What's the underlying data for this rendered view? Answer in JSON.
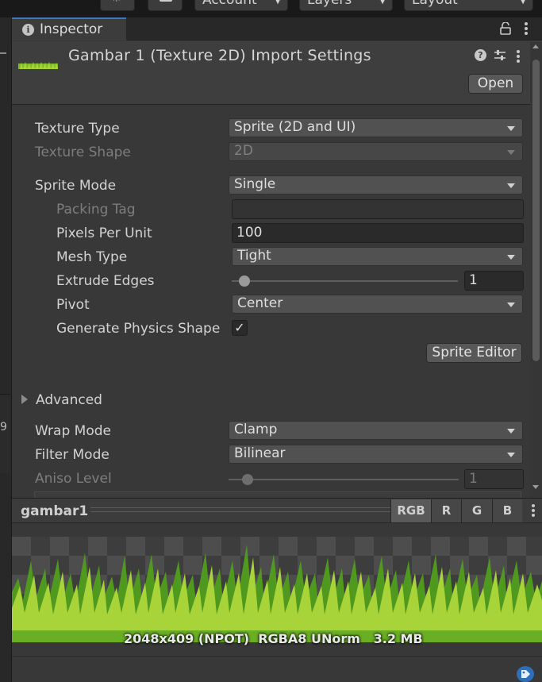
{
  "toolbar": {
    "account_label": "Account",
    "layers_label": "Layers",
    "layout_label": "Layout"
  },
  "left_strip": {
    "digit": "9"
  },
  "tab": {
    "label": "Inspector"
  },
  "header": {
    "title": "Gambar 1 (Texture 2D) Import Settings",
    "open_label": "Open"
  },
  "fields": {
    "texture_type": {
      "label": "Texture Type",
      "value": "Sprite (2D and UI)"
    },
    "texture_shape": {
      "label": "Texture Shape",
      "value": "2D"
    },
    "sprite_mode": {
      "label": "Sprite Mode",
      "value": "Single"
    },
    "packing_tag": {
      "label": "Packing Tag",
      "value": ""
    },
    "pixels_per_unit": {
      "label": "Pixels Per Unit",
      "value": "100"
    },
    "mesh_type": {
      "label": "Mesh Type",
      "value": "Tight"
    },
    "extrude_edges": {
      "label": "Extrude Edges",
      "value": "1"
    },
    "pivot": {
      "label": "Pivot",
      "value": "Center"
    },
    "generate_physics_shape": {
      "label": "Generate Physics Shape",
      "checked": "✓"
    },
    "sprite_editor_label": "Sprite Editor",
    "advanced_label": "Advanced",
    "wrap_mode": {
      "label": "Wrap Mode",
      "value": "Clamp"
    },
    "filter_mode": {
      "label": "Filter Mode",
      "value": "Bilinear"
    },
    "aniso_level": {
      "label": "Aniso Level",
      "value": "1"
    }
  },
  "preview": {
    "title": "gambar1",
    "channels": [
      "RGB",
      "R",
      "G",
      "B"
    ],
    "info": "2048x409 (NPOT)  RGBA8 UNorm   3.2 MB"
  },
  "colors": {
    "tab_accent": "#3a79bb",
    "grass_light": "#a8d43a",
    "grass_dark": "#4f9a1e",
    "tag_icon": "#2d6fb8"
  }
}
